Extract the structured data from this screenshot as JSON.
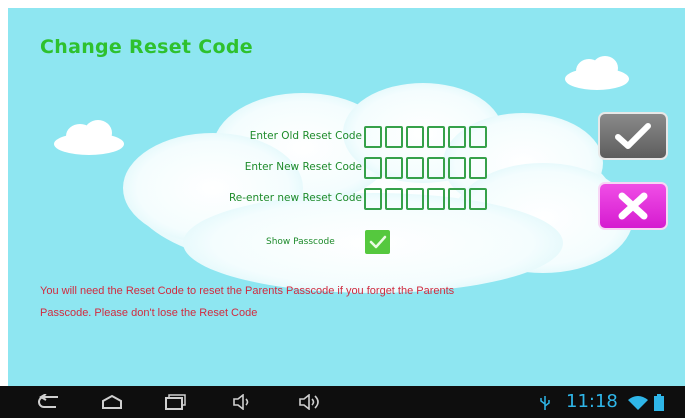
{
  "page": {
    "title": "Change Reset Code"
  },
  "form": {
    "fields": [
      {
        "label": "Enter Old  Reset Code",
        "digits": 6
      },
      {
        "label": "Enter New Reset Code",
        "digits": 6
      },
      {
        "label": "Re-enter new Reset Code",
        "digits": 6
      }
    ],
    "show_passcode_label": "Show Passcode",
    "show_passcode_checked": true
  },
  "notice": {
    "line1": "You will need the Reset Code to reset the Parents Passcode if you forget the Parents",
    "line2": "Passcode. Please don't lose the Reset Code"
  },
  "actions": {
    "confirm_icon": "checkmark-icon",
    "cancel_icon": "close-x-icon"
  },
  "statusbar": {
    "time": "11:18",
    "icons": [
      "usb-icon",
      "wifi-icon",
      "battery-icon"
    ]
  },
  "navbar": {
    "icons": [
      "back-icon",
      "home-icon",
      "recent-apps-icon",
      "volume-down-icon",
      "volume-up-icon"
    ]
  },
  "colors": {
    "background": "#8ee6f1",
    "title": "#2ec12e",
    "label": "#1e8b2b",
    "notice": "#d12b3f",
    "confirm_button": "#707070",
    "cancel_button": "#e234de",
    "clock": "#2fb6e8"
  }
}
